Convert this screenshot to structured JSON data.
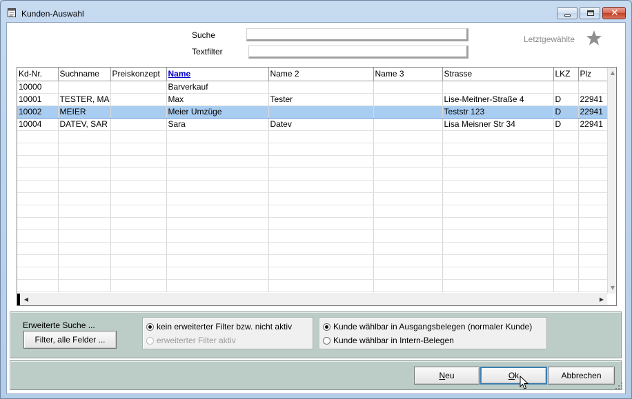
{
  "window": {
    "title": "Kunden-Auswahl",
    "icon": "notepad-icon"
  },
  "search": {
    "label": "Suche",
    "value": "",
    "textfilter_label": "Textfilter",
    "textfilter_value": ""
  },
  "recent": {
    "label": "Letztgewählte",
    "icon": "star-icon"
  },
  "table": {
    "columns": [
      "Kd-Nr.",
      "Suchname",
      "Preiskonzept",
      "Name",
      "Name 2",
      "Name 3",
      "Strasse",
      "LKZ",
      "Plz"
    ],
    "sorted_column": "Name",
    "rows": [
      [
        "10000",
        "",
        "",
        "Barverkauf",
        "",
        "",
        "",
        "",
        ""
      ],
      [
        "10001",
        "TESTER, MA",
        "",
        "Max",
        "Tester",
        "",
        "Lise-Meitner-Straße 4",
        "D",
        "22941"
      ],
      [
        "10002",
        "MEIER",
        "",
        "Meier Umzüge",
        "",
        "",
        "Teststr 123",
        "D",
        "22941"
      ],
      [
        "10004",
        "DATEV, SAR",
        "",
        "Sara",
        "Datev",
        "",
        "Lisa Meisner Str 34",
        "D",
        "22941"
      ]
    ],
    "selected_row": 2
  },
  "extended_search": {
    "label": "Erweiterte Suche ...",
    "button_label": "Filter, alle Felder ..."
  },
  "filter_options": {
    "option1": "kein erweiterter Filter bzw. nicht aktiv",
    "option2": "erweiterter Filter aktiv"
  },
  "customer_options": {
    "option1": "Kunde wählbar in Ausgangsbelegen (normaler Kunde)",
    "option2": "Kunde wählbar in Intern-Belegen"
  },
  "buttons": {
    "new_first": "N",
    "new_rest": "eu",
    "ok_first": "O",
    "ok_rest": "k",
    "cancel": "Abbrechen"
  },
  "colors": {
    "selection": "#a9cdf0",
    "panel": "#bcccc7",
    "sorted_header": "#0000cc"
  }
}
